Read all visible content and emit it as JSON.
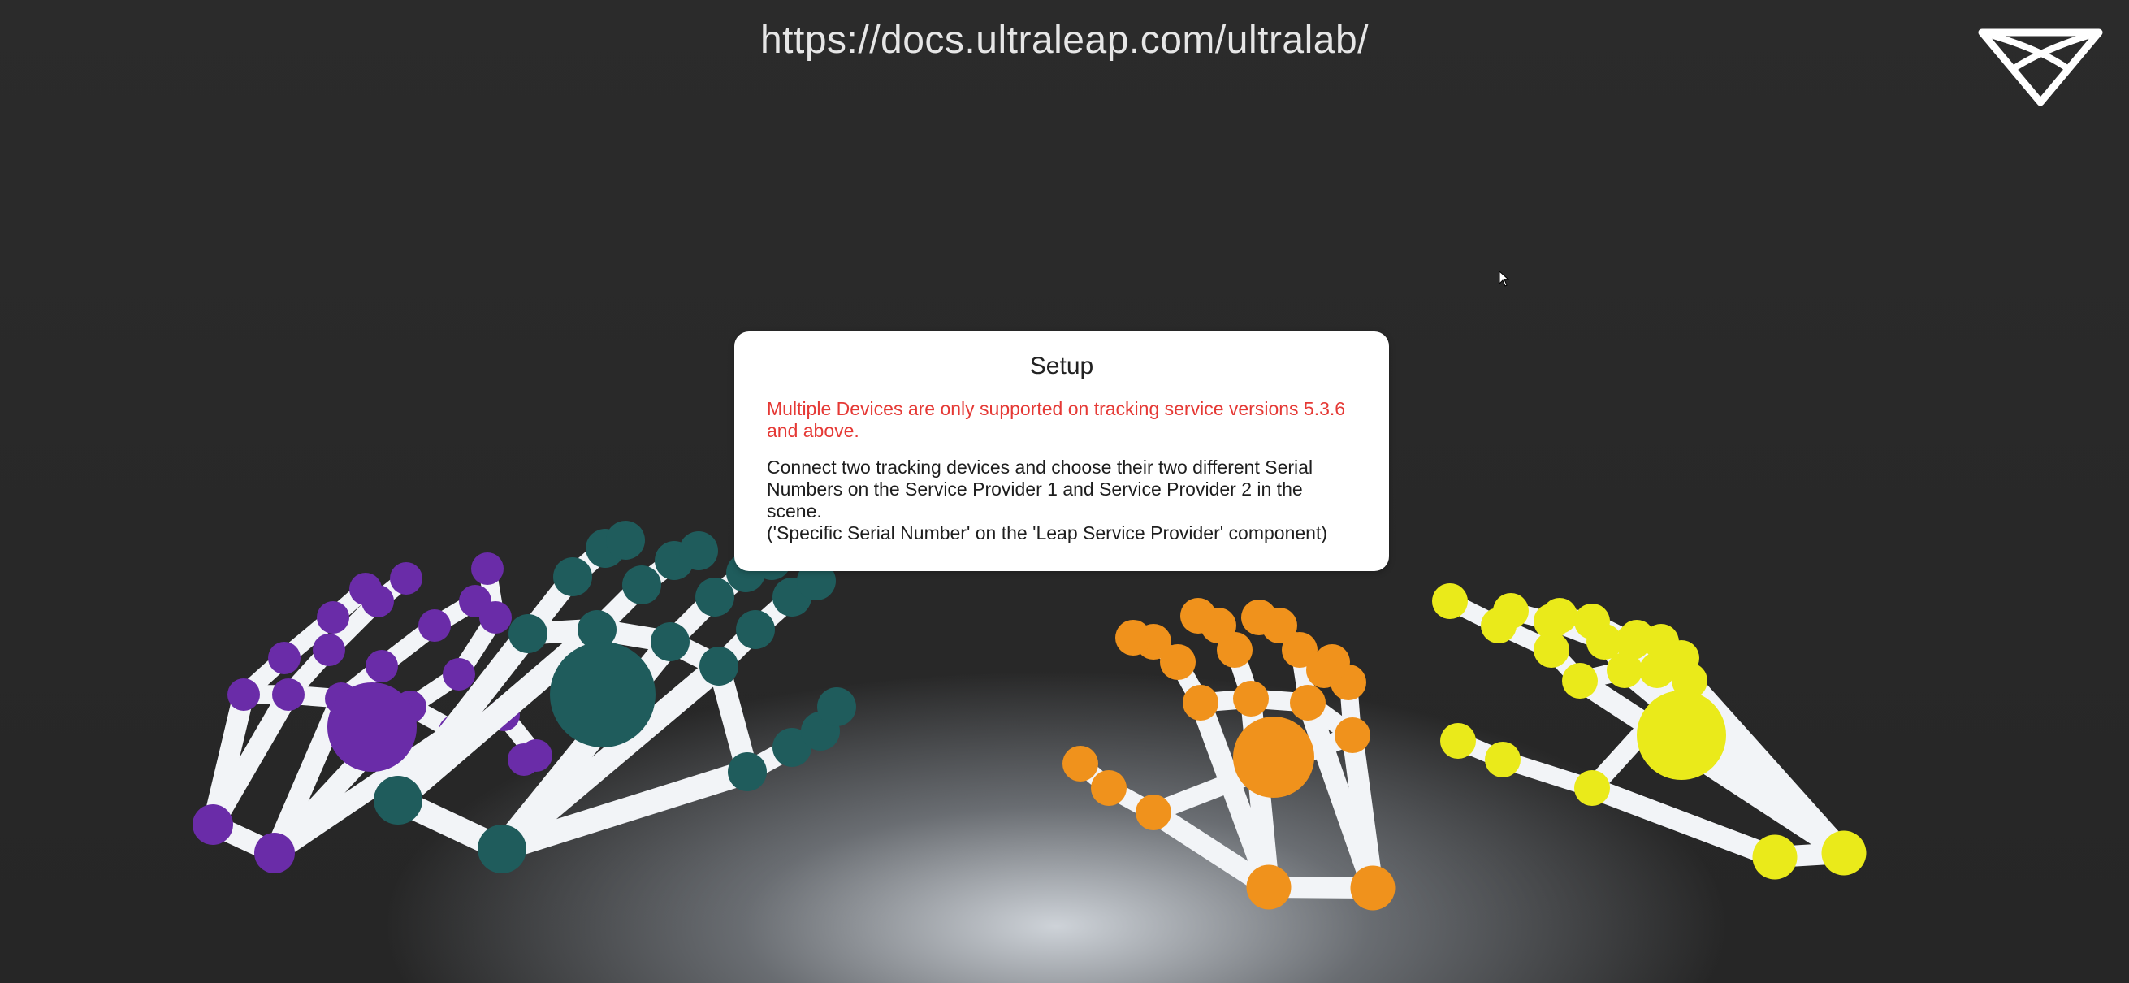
{
  "header": {
    "url_text": "https://docs.ultraleap.com/ultralab/"
  },
  "logo": {
    "icon": "ultraleap-logo-icon",
    "color": "#ffffff"
  },
  "setup_panel": {
    "title": "Setup",
    "warning": "Multiple Devices are only supported on tracking service versions 5.3.6 and above.",
    "instructions": "Connect two tracking devices and choose their two different Serial Numbers on the Service Provider 1 and Service Provider 2 in the scene.",
    "note": "('Specific Serial Number' on the 'Leap Service Provider' component)",
    "warning_color": "#e53935"
  },
  "hands": [
    {
      "name": "purple-hand",
      "joint_color": "#6a2ca8"
    },
    {
      "name": "teal-hand",
      "joint_color": "#1f5c5c"
    },
    {
      "name": "orange-hand",
      "joint_color": "#f0921c"
    },
    {
      "name": "yellow-hand",
      "joint_color": "#eaea1a"
    }
  ],
  "bone_color": "#f2f4f7"
}
